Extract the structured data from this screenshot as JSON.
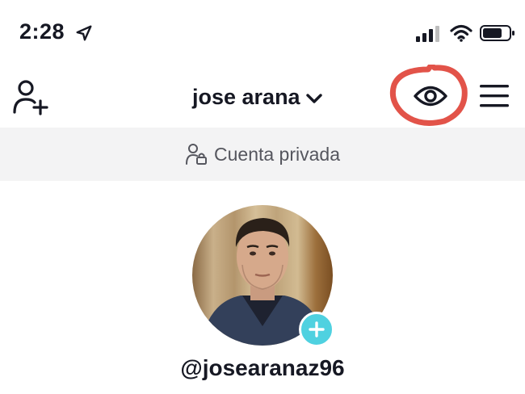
{
  "status_bar": {
    "time": "2:28",
    "icons": [
      "location-arrow-icon",
      "cellular-signal-icon",
      "wifi-icon",
      "battery-icon"
    ]
  },
  "header": {
    "username": "jose arana",
    "left_icon": "add-user-icon",
    "right_icons": [
      "eye-icon",
      "menu-icon"
    ],
    "annotation_color": "#e0443a"
  },
  "private_banner": {
    "icon": "lock-user-icon",
    "text": "Cuenta privada"
  },
  "profile": {
    "handle": "@josearanaz96",
    "avatar_badge_icon": "plus-icon",
    "badge_color": "#4fd1e0"
  }
}
